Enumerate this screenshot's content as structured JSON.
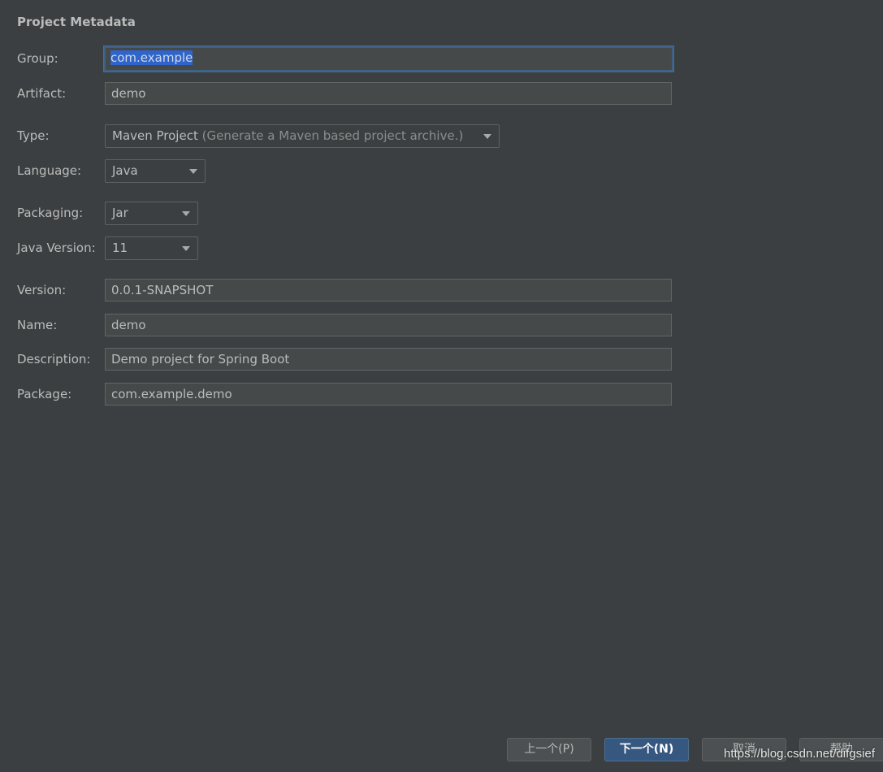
{
  "section_title": "Project Metadata",
  "fields": {
    "group": {
      "label": "Group:",
      "value": "com.example"
    },
    "artifact": {
      "label": "Artifact:",
      "value": "demo"
    },
    "type": {
      "label": "Type:",
      "value": "Maven Project",
      "hint": "(Generate a Maven based project archive.)"
    },
    "language": {
      "label": "Language:",
      "value": "Java"
    },
    "packaging": {
      "label": "Packaging:",
      "value": "Jar"
    },
    "java_version": {
      "label": "Java Version:",
      "value": "11"
    },
    "version": {
      "label": "Version:",
      "value": "0.0.1-SNAPSHOT"
    },
    "name": {
      "label": "Name:",
      "value": "demo"
    },
    "description": {
      "label": "Description:",
      "value": "Demo project for Spring Boot"
    },
    "package": {
      "label": "Package:",
      "value": "com.example.demo"
    }
  },
  "buttons": {
    "previous": "上一个(P)",
    "next": "下一个(N)",
    "cancel": "取消",
    "help": "帮助"
  },
  "watermark": "https://blog.csdn.net/difgsief",
  "colors": {
    "background": "#3c3f41",
    "field_bg": "#45494a",
    "selection": "#2f65ca",
    "primary_button": "#365880",
    "focus_border": "#3d6185"
  }
}
